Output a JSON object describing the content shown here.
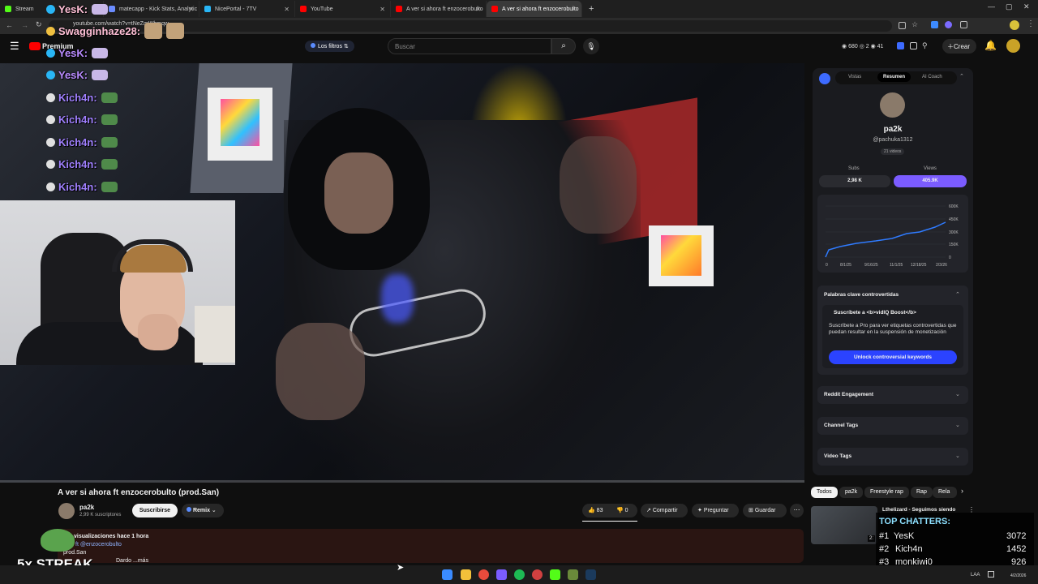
{
  "browser": {
    "tabs": [
      {
        "title": "Stream",
        "color": "#53fc18"
      },
      {
        "title": "matecapp - Kick Stats, Analytic",
        "color": "#6b8cff"
      },
      {
        "title": "NicePortal - 7TV",
        "color": "#29b6f6"
      },
      {
        "title": "YouTube",
        "color": "#ff0000"
      },
      {
        "title": "A ver si ahora ft enzocerobulto",
        "color": "#ff0000"
      },
      {
        "title": "A ver si ahora ft enzocerobulto",
        "color": "#ff0000"
      }
    ],
    "new_tab": "+",
    "url": "youtube.com/watch?v=tNeZmWhmqw"
  },
  "youtube": {
    "logo_text": "Premium",
    "filters_label": "Los filtros",
    "search_placeholder": "Buscar",
    "stats": {
      "a": "680",
      "b": "2",
      "c": "41"
    },
    "create_label": "Crear"
  },
  "video_info": {
    "title": "A ver si ahora ft enzocerobulto (prod.San)",
    "channel": "pa2k",
    "subscribers": "2,99 K suscriptores",
    "subscribe_label": "Suscribirse",
    "remix_label": "Remix",
    "likes": "83",
    "dislikes": "0",
    "share_label": "Compartir",
    "ask_label": "Preguntar",
    "save_label": "Guardar",
    "desc_views": "visualizaciones  hace 1 hora",
    "desc_line2": "ft @enzocerobulto",
    "desc_line3": "prod.San",
    "desc_line4": "Dardo ...más"
  },
  "vidiq": {
    "tabs": [
      "Vistas",
      "Resumen",
      "AI Coach"
    ],
    "channel_name": "pa2k",
    "handle": "@pachuka1312",
    "videos": "21 videos",
    "subs_label": "Subs",
    "subs_value": "2,98 K",
    "views_label": "Views",
    "views_value": "405.9K",
    "chart": {
      "y_ticks": [
        "600K",
        "450K",
        "300K",
        "150K",
        "0"
      ],
      "x_ticks": [
        "0",
        "8/1/25",
        "9/16/25",
        "11/1/25",
        "12/18/25",
        "2/3/26"
      ]
    },
    "keywords_title": "Palabras clave controvertidas",
    "keywords_promo": "Suscríbete a <b>vidIQ Boost</b>",
    "keywords_desc": "Suscríbete a Pro para ver etiquetas controvertidas que puedan resultar en la suspensión de monetización",
    "unlock_label": "Unlock controversial keywords",
    "sections": [
      "Reddit Engagement",
      "Channel Tags",
      "Video Tags"
    ]
  },
  "chips": [
    "Todos",
    "pa2k",
    "Freestyle rap",
    "Rap",
    "Rela"
  ],
  "related": {
    "title": "Lthelizard - Seguimos siendo",
    "duration": "2:"
  },
  "chat": [
    {
      "user": "YesK:",
      "color": "#ffbfd6"
    },
    {
      "user": "Swagginhaze28:",
      "color": "#ffbfd6"
    },
    {
      "user": "YesK:",
      "color": "#b98bff"
    },
    {
      "user": "YesK:",
      "color": "#b98bff"
    },
    {
      "user": "Kich4n:",
      "color": "#a080ff"
    },
    {
      "user": "Kich4n:",
      "color": "#a080ff"
    },
    {
      "user": "Kich4n:",
      "color": "#a080ff"
    },
    {
      "user": "Kich4n:",
      "color": "#a080ff"
    },
    {
      "user": "Kich4n:",
      "color": "#a080ff"
    }
  ],
  "streak": "5x STREAK",
  "top_chatters": {
    "title": "TOP CHATTERS:",
    "rows": [
      {
        "rank": "#1",
        "name": "YesK",
        "count": "3072"
      },
      {
        "rank": "#2",
        "name": "Kich4n",
        "count": "1452"
      },
      {
        "rank": "#3",
        "name": "monkiwi0",
        "count": "926"
      }
    ]
  },
  "taskbar": {
    "lang": "LAA",
    "date": "4/2/2026"
  }
}
